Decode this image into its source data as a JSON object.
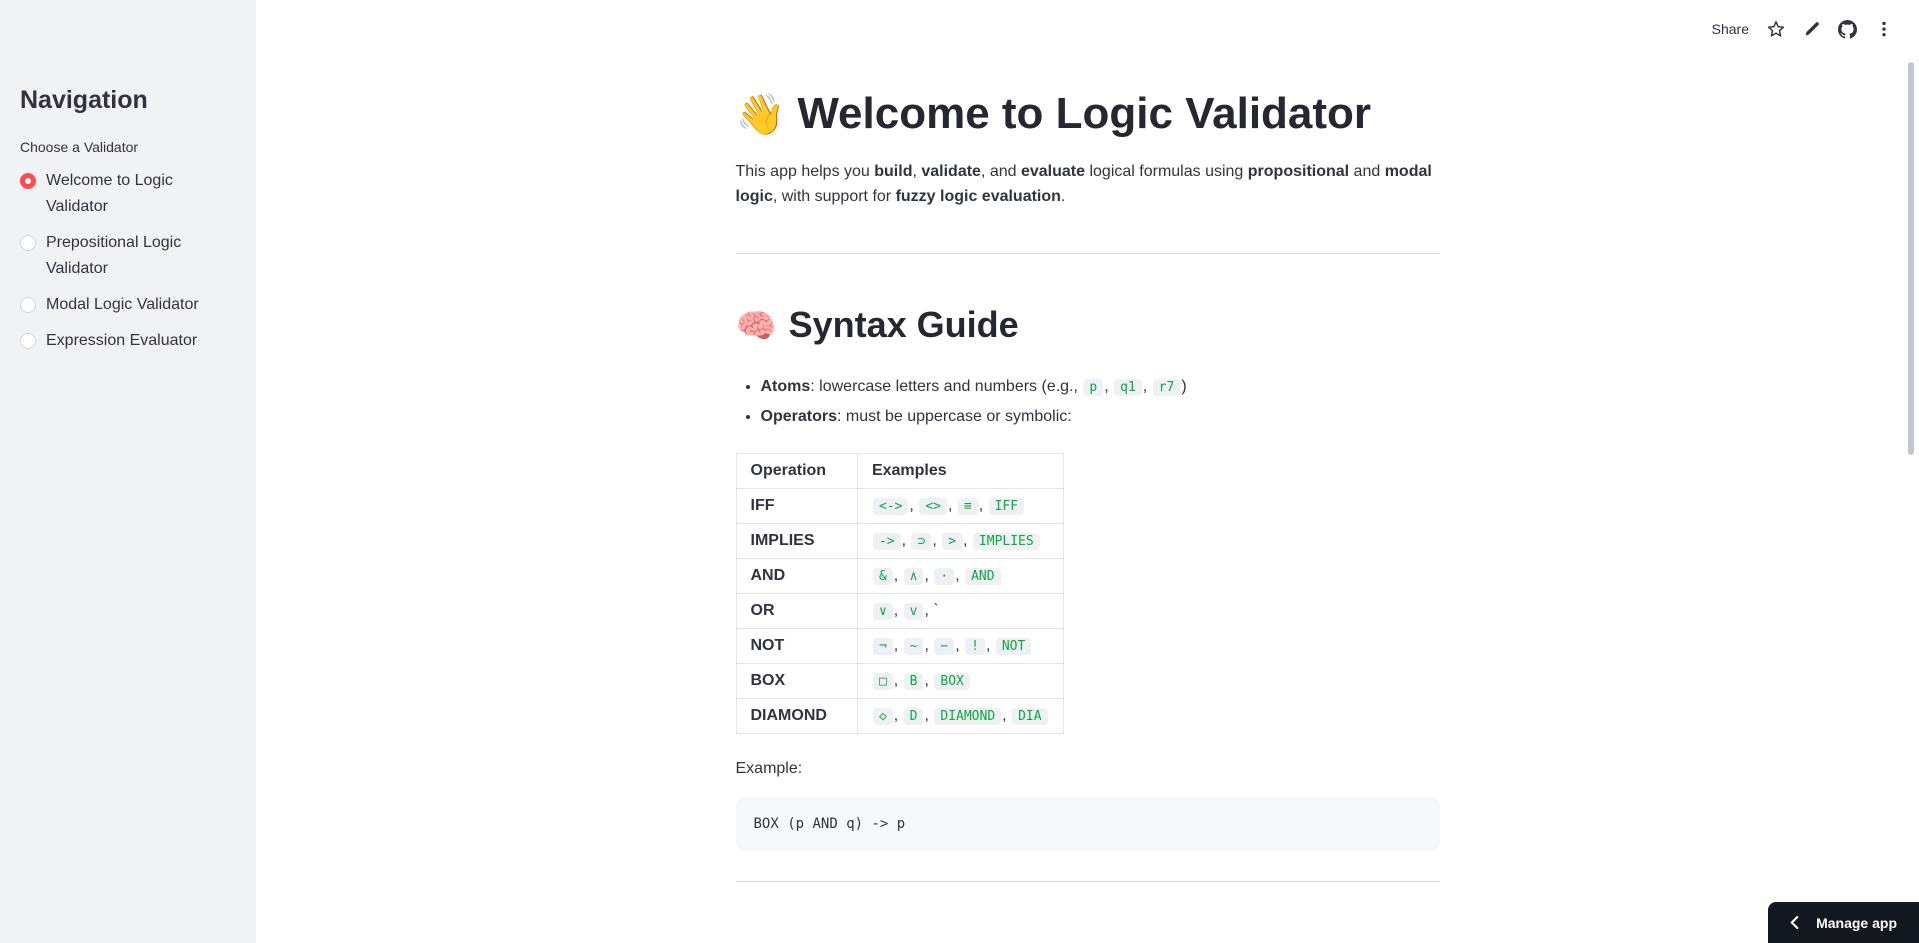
{
  "colors": {
    "accent_red": "#ff4b4b",
    "code_green": "#09ab3b",
    "sidebar_bg": "#f0f2f6",
    "text_dark": "#31333f",
    "manage_app_bg": "#131720"
  },
  "toolbar": {
    "share_label": "Share",
    "icons": [
      "star-icon",
      "edit-pencil-icon",
      "github-icon",
      "overflow-menu-icon"
    ]
  },
  "sidebar": {
    "title": "Navigation",
    "widget_label": "Choose a Validator",
    "options": [
      {
        "label": "Welcome to Logic Validator",
        "selected": true
      },
      {
        "label": "Prepositional Logic Validator",
        "selected": false
      },
      {
        "label": "Modal Logic Validator",
        "selected": false
      },
      {
        "label": "Expression Evaluator",
        "selected": false
      }
    ]
  },
  "main": {
    "welcome": {
      "emoji": "👋",
      "title": "Welcome to Logic Validator",
      "intro": [
        {
          "v": "This app helps you "
        },
        {
          "v": "build",
          "bold": true
        },
        {
          "v": ", "
        },
        {
          "v": "validate",
          "bold": true
        },
        {
          "v": ", and "
        },
        {
          "v": "evaluate",
          "bold": true
        },
        {
          "v": " logical formulas using "
        },
        {
          "v": "propositional",
          "bold": true
        },
        {
          "v": " and "
        },
        {
          "v": "modal logic",
          "bold": true
        },
        {
          "v": ", with support for "
        },
        {
          "v": "fuzzy logic evaluation",
          "bold": true
        },
        {
          "v": "."
        }
      ]
    },
    "syntax": {
      "emoji": "🧠",
      "title": "Syntax Guide",
      "bullets": [
        [
          {
            "v": "Atoms",
            "bold": true
          },
          {
            "v": ": lowercase letters and numbers (e.g., "
          },
          {
            "v": "p",
            "code": true
          },
          {
            "v": ", "
          },
          {
            "v": "q1",
            "code": true
          },
          {
            "v": ", "
          },
          {
            "v": "r7",
            "code": true
          },
          {
            "v": ")"
          }
        ],
        [
          {
            "v": "Operators",
            "bold": true
          },
          {
            "v": ": must be uppercase or symbolic:"
          }
        ]
      ],
      "table": {
        "headers": [
          "Operation",
          "Examples"
        ],
        "rows": [
          {
            "operation": "IFF",
            "examples": [
              {
                "v": "<->",
                "code": true
              },
              {
                "v": "<>",
                "code": true
              },
              {
                "v": "≡",
                "code": true
              },
              {
                "v": "IFF",
                "code": true
              }
            ]
          },
          {
            "operation": "IMPLIES",
            "examples": [
              {
                "v": "->",
                "code": true
              },
              {
                "v": "⊃",
                "code": true
              },
              {
                "v": ">",
                "code": true
              },
              {
                "v": "IMPLIES",
                "code": true
              }
            ]
          },
          {
            "operation": "AND",
            "examples": [
              {
                "v": "&",
                "code": true
              },
              {
                "v": "∧",
                "code": true
              },
              {
                "v": "·",
                "code": true
              },
              {
                "v": "AND",
                "code": true
              }
            ]
          },
          {
            "operation": "OR",
            "examples": [
              {
                "v": "∨",
                "code": true
              },
              {
                "v": "v",
                "code": true
              },
              {
                "v": "`",
                "code": false
              }
            ]
          },
          {
            "operation": "NOT",
            "examples": [
              {
                "v": "¬",
                "code": true
              },
              {
                "v": "~",
                "code": true
              },
              {
                "v": "−",
                "code": true
              },
              {
                "v": "!",
                "code": true
              },
              {
                "v": "NOT",
                "code": true
              }
            ]
          },
          {
            "operation": "BOX",
            "examples": [
              {
                "v": "□",
                "code": true
              },
              {
                "v": "B",
                "code": true
              },
              {
                "v": "BOX",
                "code": true
              }
            ]
          },
          {
            "operation": "DIAMOND",
            "examples": [
              {
                "v": "◇",
                "code": true
              },
              {
                "v": "D",
                "code": true
              },
              {
                "v": "DIAMOND",
                "code": true
              },
              {
                "v": "DIA",
                "code": true
              }
            ]
          }
        ]
      },
      "example_label": "Example:",
      "example_code": "BOX (p AND q) -> p"
    }
  },
  "manage_app": {
    "label": "Manage app"
  }
}
